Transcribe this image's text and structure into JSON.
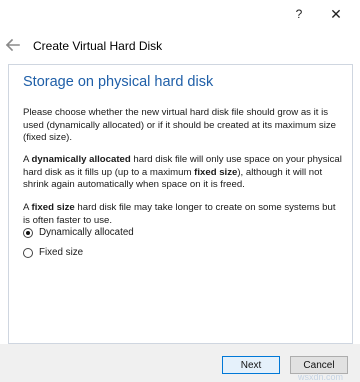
{
  "titlebar": {
    "help_label": "?",
    "close_label": "✕"
  },
  "nav": {
    "title": "Create Virtual Hard Disk",
    "back_icon": "back-arrow-icon"
  },
  "main": {
    "heading": "Storage on physical hard disk",
    "paragraph1": "Please choose whether the new virtual hard disk file should grow as it is used (dynamically allocated) or if it should be created at its maximum size (fixed size).",
    "paragraph2": {
      "prefix": "A ",
      "bold1": "dynamically allocated",
      "middle": " hard disk file will only use space on your physical hard disk as it fills up (up to a maximum ",
      "bold2": "fixed size",
      "suffix": "), although it will not shrink again automatically when space on it is freed."
    },
    "paragraph3": {
      "prefix": "A ",
      "bold1": "fixed size",
      "suffix": " hard disk file may take longer to create on some systems but is often faster to use."
    },
    "options": [
      {
        "label": "Dynamically allocated",
        "selected": true
      },
      {
        "label": "Fixed size",
        "selected": false
      }
    ]
  },
  "footer": {
    "next_label": "Next",
    "cancel_label": "Cancel"
  },
  "watermark": "wsxdn.com"
}
